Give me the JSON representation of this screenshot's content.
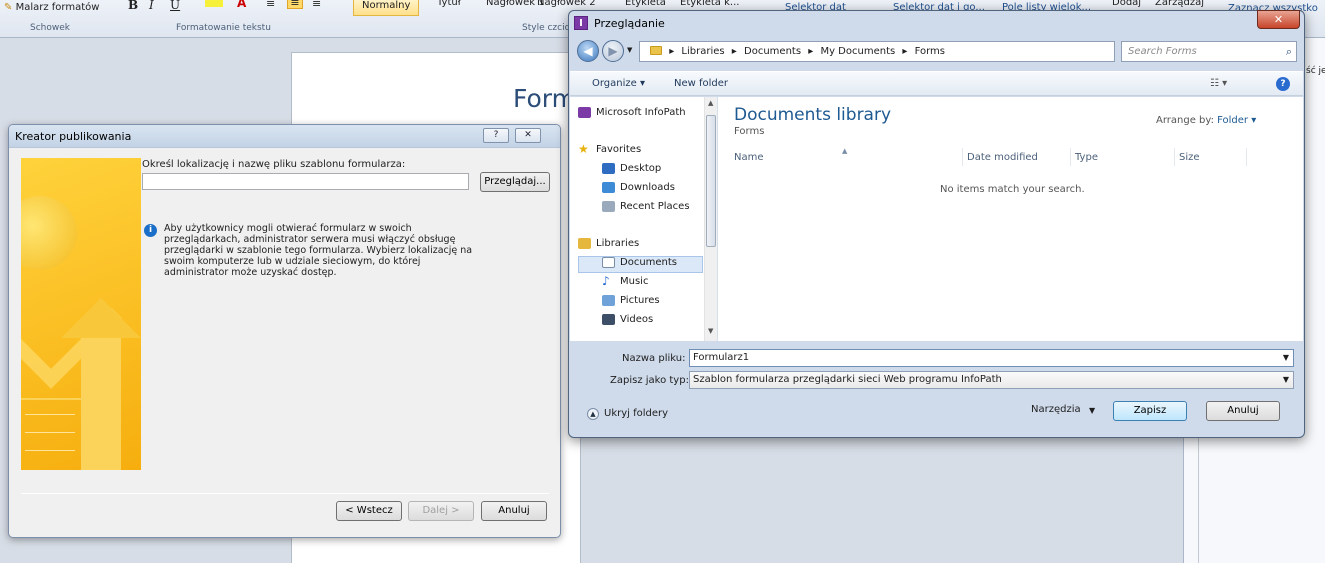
{
  "background": {
    "ribbon": {
      "format_painter": "Malarz formatów",
      "group_clipboard": "Schowek",
      "group_text_format": "Formatowanie tekstu",
      "group_styles": "Style czcio",
      "style_normal": "Normalny",
      "style_title": "Tytuł",
      "style_h1": "Nagłówek 1",
      "style_h2": "Nagłówek 2",
      "style_label": "Etykieta",
      "style_label_k": "Etykieta k...",
      "ctrl_date_picker": "Selektor dat",
      "ctrl_date_and_time": "Selektor dat i go...",
      "ctrl_multi_list": "Pole listy wielok...",
      "add": "Dodaj",
      "manage": "Zarządzaj",
      "select_all": "Zaznacz wszystko",
      "peek_text": "ść je"
    },
    "document": {
      "title_fragment": "Form"
    }
  },
  "wizard": {
    "title": "Kreator publikowania",
    "help_button": "?",
    "close_button": "✕",
    "location_label": "Określ lokalizację i nazwę pliku szablonu formularza:",
    "location_value": "",
    "browse_button": "Przeglądaj...",
    "info_text": "Aby użytkownicy mogli otwierać formularz w swoich przeglądarkach, administrator serwera musi włączyć obsługę przeglądarki w szablonie tego formularza. Wybierz lokalizację na swoim komputerze lub w udziale sieciowym, do której administrator może uzyskać dostęp.",
    "back_button": "< Wstecz",
    "next_button": "Dalej >",
    "cancel_button": "Anuluj"
  },
  "save_dialog": {
    "title": "Przeglądanie",
    "close_button": "✕",
    "breadcrumbs": [
      "Libraries",
      "Documents",
      "My Documents",
      "Forms"
    ],
    "search_placeholder": "Search Forms",
    "toolbar": {
      "organize": "Organize ▾",
      "new_folder": "New folder"
    },
    "nav_pane": {
      "infopath": "Microsoft InfoPath",
      "favorites": "Favorites",
      "desktop": "Desktop",
      "downloads": "Downloads",
      "recent_places": "Recent Places",
      "libraries": "Libraries",
      "documents": "Documents",
      "music": "Music",
      "pictures": "Pictures",
      "videos": "Videos"
    },
    "library_title": "Documents library",
    "library_subtitle": "Forms",
    "arrange_by_label": "Arrange by:",
    "arrange_by_value": "Folder ▾",
    "columns": {
      "name": "Name",
      "date_modified": "Date modified",
      "type": "Type",
      "size": "Size"
    },
    "empty_message": "No items match your search.",
    "file_name_label": "Nazwa pliku:",
    "file_name_value": "Formularz1",
    "save_as_type_label": "Zapisz jako typ:",
    "save_as_type_value": "Szablon formularza przeglądarki sieci Web programu InfoPath",
    "hide_folders": "Ukryj foldery",
    "tools": "Narzędzia",
    "save_button": "Zapisz",
    "cancel_button": "Anuluj"
  }
}
